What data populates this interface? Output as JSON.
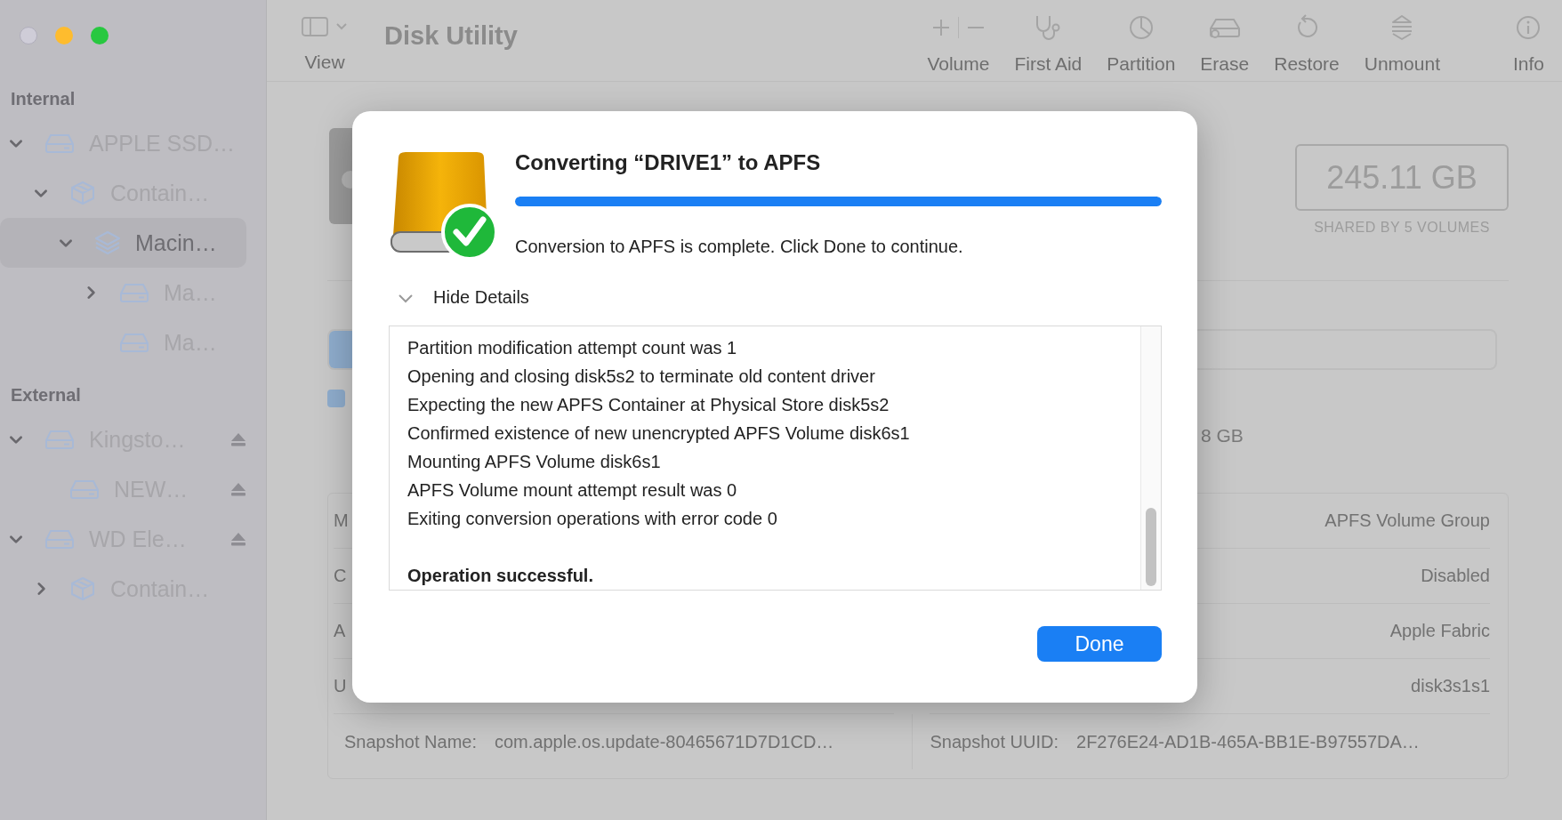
{
  "window": {
    "title": "Disk Utility"
  },
  "toolbar": {
    "view_label": "View",
    "items": [
      {
        "label": "Volume",
        "kind": "volume"
      },
      {
        "label": "First Aid",
        "kind": "first-aid"
      },
      {
        "label": "Partition",
        "kind": "partition"
      },
      {
        "label": "Erase",
        "kind": "erase"
      },
      {
        "label": "Restore",
        "kind": "restore"
      },
      {
        "label": "Unmount",
        "kind": "unmount"
      },
      {
        "label": "Info",
        "kind": "info"
      }
    ]
  },
  "sidebar": {
    "sections": [
      {
        "title": "Internal",
        "items": [
          {
            "label": "APPLE SSD…",
            "kind": "disk",
            "has_children": true,
            "expanded": true,
            "selected": false,
            "ejectable": false,
            "children": [
              {
                "label": "Contain…",
                "kind": "container",
                "has_children": true,
                "expanded": true,
                "selected": false,
                "ejectable": false,
                "children": [
                  {
                    "label": "Macin…",
                    "kind": "volume-group",
                    "has_children": true,
                    "expanded": true,
                    "selected": true,
                    "ejectable": false,
                    "children": [
                      {
                        "label": "Ma…",
                        "kind": "disk",
                        "has_children": true,
                        "expanded": false,
                        "selected": false,
                        "ejectable": false
                      },
                      {
                        "label": "Ma…",
                        "kind": "disk",
                        "has_children": false,
                        "expanded": false,
                        "selected": false,
                        "ejectable": false
                      }
                    ]
                  }
                ]
              }
            ]
          }
        ]
      },
      {
        "title": "External",
        "items": [
          {
            "label": "Kingsto…",
            "kind": "disk",
            "has_children": true,
            "expanded": true,
            "selected": false,
            "ejectable": true,
            "children": [
              {
                "label": "NEW…",
                "kind": "disk",
                "has_children": false,
                "expanded": false,
                "selected": false,
                "ejectable": true
              }
            ]
          },
          {
            "label": "WD Ele…",
            "kind": "disk",
            "has_children": true,
            "expanded": true,
            "selected": false,
            "ejectable": true,
            "children": [
              {
                "label": "Contain…",
                "kind": "container",
                "has_children": true,
                "expanded": false,
                "selected": false,
                "ejectable": false
              }
            ]
          }
        ]
      }
    ]
  },
  "detail": {
    "capacity": "245.11 GB",
    "capacity_note": "SHARED BY 5 VOLUMES",
    "usage_fragment": "8 GB",
    "info_rows": [
      {
        "label": "M",
        "value": "APFS Volume Group"
      },
      {
        "label": "C",
        "value": "Disabled"
      },
      {
        "label": "A",
        "value": "Apple Fabric"
      },
      {
        "label": "U",
        "value": "disk3s1s1"
      }
    ],
    "snapshot": {
      "name_label": "Snapshot Name:",
      "name": "com.apple.os.update-80465671D7D1CD…",
      "uuid_label": "Snapshot UUID:",
      "uuid": "2F276E24-AD1B-465A-BB1E-B97557DA…"
    }
  },
  "dialog": {
    "title": "Converting “DRIVE1” to APFS",
    "progress": {
      "level": 1.0
    },
    "message": "Conversion to APFS is complete. Click Done to continue.",
    "details_toggle": {
      "label": "Hide Details",
      "expanded": true
    },
    "log": [
      "Partition modification attempt count was 1",
      "Opening and closing disk5s2 to terminate old content driver",
      "Expecting the new APFS Container at Physical Store disk5s2",
      "Confirmed existence of new unencrypted APFS Volume disk6s1",
      "Mounting APFS Volume disk6s1",
      "APFS Volume mount attempt result was 0",
      "Exiting conversion operations with error code 0"
    ],
    "log_result": "Operation successful.",
    "button": "Done"
  }
}
